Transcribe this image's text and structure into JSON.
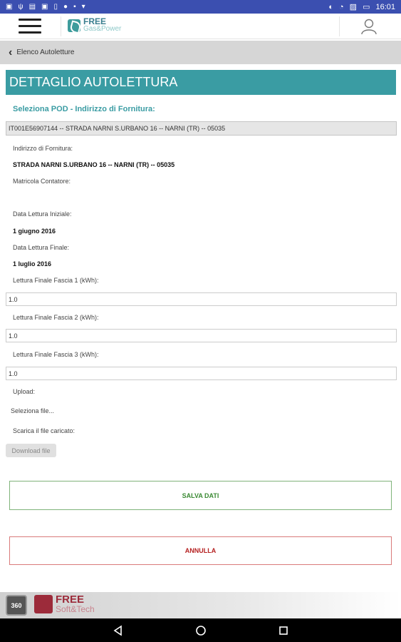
{
  "status_bar": {
    "time": "16:01"
  },
  "header": {
    "logo_line1": "FREE",
    "logo_line2": "Gas&Power"
  },
  "breadcrumb": {
    "label": "Elenco Autoletture"
  },
  "page_title": "DETTAGLIO AUTOLETTURA",
  "pod": {
    "label": "Seleziona POD - Indirizzo di Fornitura:",
    "selected": "IT001E56907144 -- STRADA NARNI S.URBANO 16 -- NARNI (TR) -- 05035"
  },
  "details": {
    "indirizzo_label": "Indirizzo di Fornitura:",
    "indirizzo_value": "STRADA NARNI S.URBANO 16 -- NARNI (TR) -- 05035",
    "matricola_label": "Matricola Contatore:",
    "matricola_value": "",
    "data_iniziale_label": "Data Lettura Iniziale:",
    "data_iniziale_value": "1 giugno 2016",
    "data_finale_label": "Data Lettura Finale:",
    "data_finale_value": "1 luglio 2016"
  },
  "readings": [
    {
      "label": "Lettura Finale Fascia 1 (kWh):",
      "value": "1.0"
    },
    {
      "label": "Lettura Finale Fascia 2 (kWh):",
      "value": "1.0"
    },
    {
      "label": "Lettura Finale Fascia 3 (kWh):",
      "value": "1.0"
    }
  ],
  "upload": {
    "label": "Upload:",
    "select_file": "Seleziona file...",
    "download_label": "Scarica il file caricato:",
    "download_button": "Download file"
  },
  "actions": {
    "save": "SALVA DATI",
    "cancel": "ANNULLA"
  },
  "footer": {
    "badge": "360",
    "brand_line1": "FREE",
    "brand_line2": "Soft&Tech"
  },
  "colors": {
    "status_bar": "#3b4fb0",
    "accent": "#3a9ca3",
    "save": "#3b8a34",
    "cancel": "#b52020"
  }
}
